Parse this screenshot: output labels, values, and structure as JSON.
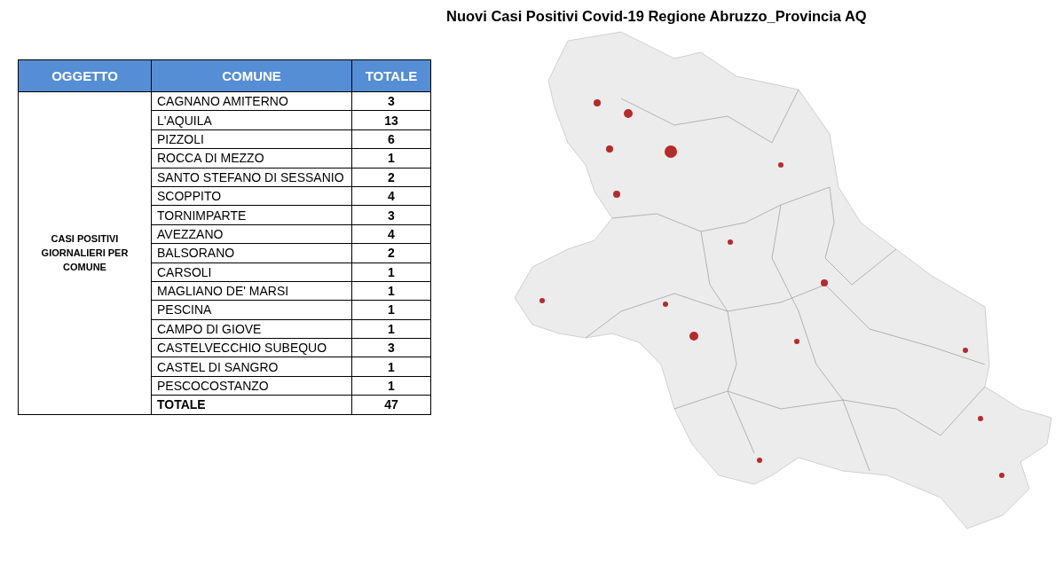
{
  "title": "Nuovi Casi Positivi Covid-19 Regione Abruzzo_Provincia AQ",
  "table": {
    "columns": [
      "OGGETTO",
      "COMUNE",
      "TOTALE"
    ],
    "group_label": "CASI POSITIVI GIORNALIERI PER COMUNE",
    "rows": [
      {
        "comune": "CAGNANO AMITERNO",
        "totale": "3"
      },
      {
        "comune": "L'AQUILA",
        "totale": "13"
      },
      {
        "comune": "PIZZOLI",
        "totale": "6"
      },
      {
        "comune": "ROCCA DI MEZZO",
        "totale": "1"
      },
      {
        "comune": "SANTO STEFANO DI SESSANIO",
        "totale": "2"
      },
      {
        "comune": "SCOPPITO",
        "totale": "4"
      },
      {
        "comune": "TORNIMPARTE",
        "totale": "3"
      },
      {
        "comune": "AVEZZANO",
        "totale": "4"
      },
      {
        "comune": "BALSORANO",
        "totale": "2"
      },
      {
        "comune": "CARSOLI",
        "totale": "1"
      },
      {
        "comune": "MAGLIANO DE' MARSI",
        "totale": "1"
      },
      {
        "comune": "PESCINA",
        "totale": "1"
      },
      {
        "comune": "CAMPO DI GIOVE",
        "totale": "1"
      },
      {
        "comune": "CASTELVECCHIO SUBEQUO",
        "totale": "3"
      },
      {
        "comune": "CASTEL DI SANGRO",
        "totale": "1"
      },
      {
        "comune": "PESCOCOSTANZO",
        "totale": "1"
      }
    ],
    "total_row": {
      "label": "TOTALE",
      "value": "47"
    }
  }
}
